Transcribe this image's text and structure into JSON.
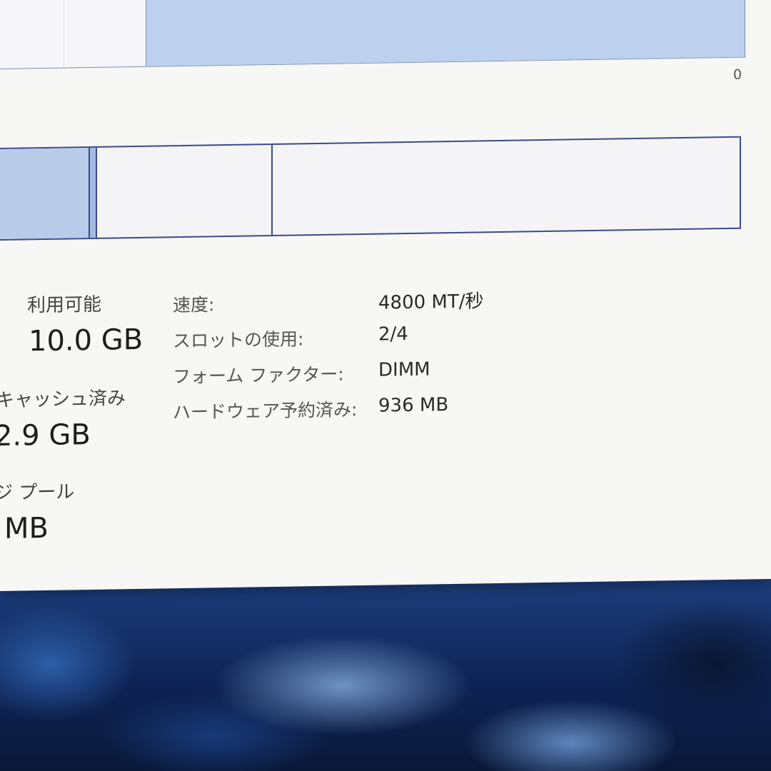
{
  "graph": {
    "axis_min_label": "0"
  },
  "stats": {
    "available": {
      "label": "利用可能",
      "value": "10.0 GB"
    },
    "cached": {
      "label": "キャッシュ済み",
      "value": "2.9 GB"
    },
    "paged_pool": {
      "label": "ジ プール",
      "value": "MB"
    }
  },
  "details": [
    {
      "label": "速度:",
      "value": "4800 MT/秒"
    },
    {
      "label": "スロットの使用:",
      "value": "2/4"
    },
    {
      "label": "フォーム ファクター:",
      "value": "DIMM"
    },
    {
      "label": "ハードウェア予約済み:",
      "value": "936 MB"
    }
  ],
  "colors": {
    "window_bg": "#f7f7f6",
    "graph_fill": "#bdd1ee",
    "graph_border": "#3b4a8a",
    "wallpaper": "#1d3f7e"
  }
}
